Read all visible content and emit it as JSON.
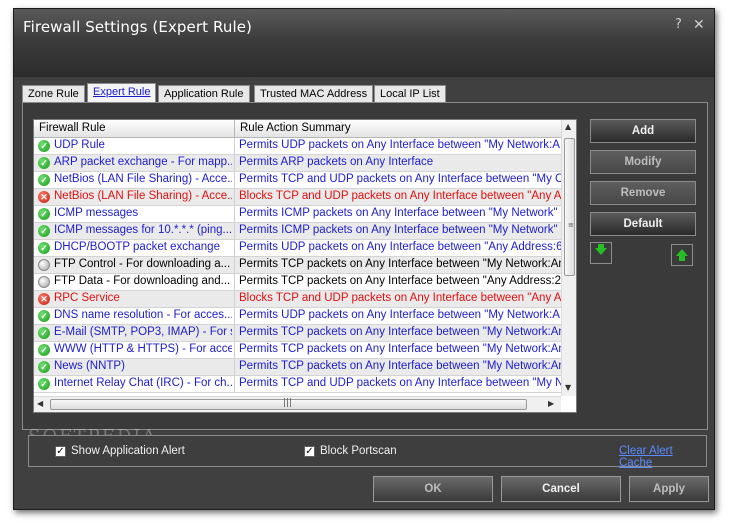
{
  "window": {
    "title": "Firewall Settings (Expert Rule)",
    "help_glyph": "?",
    "close_glyph": "✕"
  },
  "tabs": [
    {
      "label": "Zone Rule",
      "active": false
    },
    {
      "label": "Expert Rule",
      "active": true
    },
    {
      "label": "Application Rule",
      "active": false
    },
    {
      "label": "Trusted MAC Address",
      "active": false
    },
    {
      "label": "Local IP List",
      "active": false
    }
  ],
  "table": {
    "columns": [
      "Firewall Rule",
      "Rule Action Summary"
    ],
    "rows": [
      {
        "status": "permit",
        "icon": "check-icon",
        "name": "UDP Rule",
        "summary": "Permits UDP packets on Any Interface between \"My Network:A"
      },
      {
        "status": "permit",
        "icon": "check-icon",
        "name": "ARP packet exchange - For mapp...",
        "summary": "Permits ARP packets on Any Interface"
      },
      {
        "status": "permit",
        "icon": "check-icon",
        "name": "NetBios (LAN File Sharing) - Acce...",
        "summary": "Permits TCP and UDP packets on Any Interface between \"My C"
      },
      {
        "status": "block",
        "icon": "block-icon",
        "name": "NetBios (LAN File Sharing) - Acce...",
        "summary": "Blocks TCP and UDP packets on Any Interface between \"Any A"
      },
      {
        "status": "permit",
        "icon": "check-icon",
        "name": "ICMP messages",
        "summary": "Permits ICMP packets on Any Interface between \"My Network\""
      },
      {
        "status": "permit",
        "icon": "check-icon",
        "name": "ICMP messages for  10.*.*.* (ping...",
        "summary": "Permits ICMP packets on Any Interface between \"My Network\""
      },
      {
        "status": "permit",
        "icon": "check-icon",
        "name": "DHCP/BOOTP packet exchange",
        "summary": "Permits UDP packets on Any Interface between \"Any Address:6"
      },
      {
        "status": "neutral",
        "icon": "neutral-icon",
        "name": "FTP Control - For downloading a...",
        "summary": "Permits TCP packets on Any Interface between \"My Network:An"
      },
      {
        "status": "neutral",
        "icon": "neutral-icon",
        "name": "FTP Data - For downloading and...",
        "summary": "Permits TCP packets on Any Interface between \"Any Address:20"
      },
      {
        "status": "block",
        "icon": "block-icon",
        "name": "RPC Service",
        "summary": "Blocks TCP and UDP packets on Any Interface between \"Any A"
      },
      {
        "status": "permit",
        "icon": "check-icon",
        "name": "DNS name resolution - For acces...",
        "summary": "Permits UDP packets on Any Interface between \"My Network:A"
      },
      {
        "status": "permit",
        "icon": "check-icon",
        "name": "E-Mail (SMTP, POP3, IMAP) - For s...",
        "summary": "Permits TCP packets on Any Interface between \"My Network:An"
      },
      {
        "status": "permit",
        "icon": "check-icon",
        "name": "WWW (HTTP & HTTPS) - For acces...",
        "summary": "Permits TCP packets on Any Interface between \"My Network:An"
      },
      {
        "status": "permit",
        "icon": "check-icon",
        "name": "News (NNTP)",
        "summary": "Permits TCP packets on Any Interface between \"My Network:An"
      },
      {
        "status": "permit",
        "icon": "check-icon",
        "name": "Internet Relay Chat (IRC) - For ch...",
        "summary": "Permits TCP and UDP packets on Any Interface between \"My N"
      }
    ]
  },
  "side_buttons": {
    "add": "Add",
    "modify": "Modify",
    "remove": "Remove",
    "default": "Default"
  },
  "options": {
    "show_alert_label": "Show Application Alert",
    "show_alert_checked": true,
    "block_portscan_label": "Block Portscan",
    "block_portscan_checked": true,
    "clear_cache_link": "Clear Alert Cache"
  },
  "dialog_buttons": {
    "ok": "OK",
    "cancel": "Cancel",
    "apply": "Apply"
  },
  "watermark": "SOFTPEDIA",
  "colors": {
    "permit": "#1c1cd0",
    "block": "#e01010",
    "neutral": "#000000",
    "move_arrow": "#25c025"
  }
}
